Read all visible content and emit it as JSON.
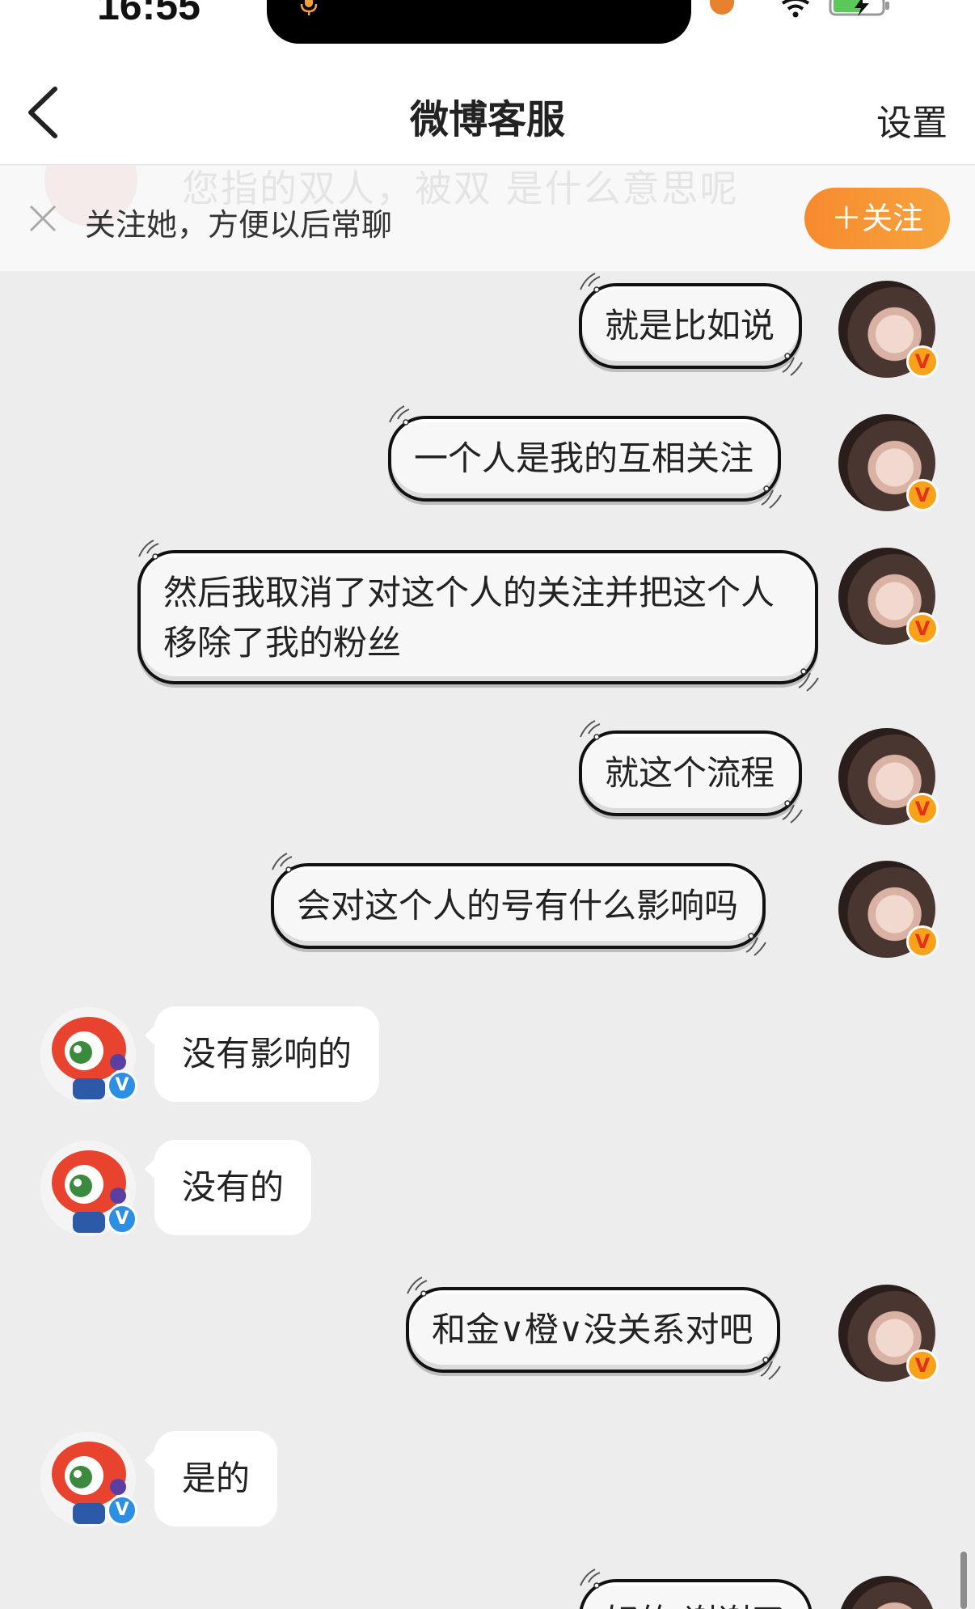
{
  "status_bar": {
    "time": "16:55"
  },
  "nav": {
    "title": "微博客服",
    "settings": "设置"
  },
  "follow_bar": {
    "ghost_text": "您指的双人，被双 是什么意思呢",
    "text": "关注她，方便以后常聊",
    "button": "＋关注"
  },
  "messages": [
    {
      "side": "right",
      "text": "就是比如说"
    },
    {
      "side": "right",
      "text": "一个人是我的互相关注"
    },
    {
      "side": "right",
      "text": "然后我取消了对这个人的关注并把这个人移除了我的粉丝"
    },
    {
      "side": "right",
      "text": "就这个流程"
    },
    {
      "side": "right",
      "text": "会对这个人的号有什么影响吗"
    },
    {
      "side": "left",
      "text": "没有影响的"
    },
    {
      "side": "left",
      "text": "没有的"
    },
    {
      "side": "right",
      "text": "和金∨橙∨没关系对吧"
    },
    {
      "side": "left",
      "text": "是的"
    },
    {
      "side": "right",
      "text": "好的 谢谢了"
    }
  ],
  "badges": {
    "user_v": "V",
    "service_v": "V"
  },
  "colors": {
    "accent": "#f78a2e",
    "service_badge": "#2d8fe3",
    "user_badge": "#f7a21a",
    "background": "#ededed"
  }
}
